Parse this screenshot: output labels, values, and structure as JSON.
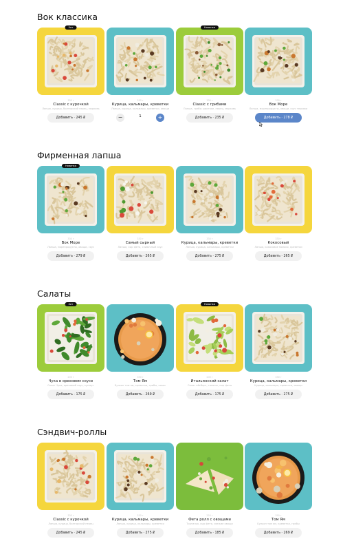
{
  "sections": [
    {
      "title": "Вок классика",
      "items": [
        {
          "name": "Classic с курочкой",
          "desc": "Лапша, курица, болгарский перец, морковь",
          "badge": "Хит",
          "button": "Добавить · 245 ₽",
          "bg": "#f5d63d",
          "food": "noodle-chicken",
          "weight": "330 г"
        },
        {
          "name": "Курица, кальмары, креветки",
          "desc": "Лапша, курица, кальмары, креветки, овощи",
          "badge": "",
          "button": "",
          "stepper": {
            "minus": "−",
            "count": "1",
            "plus": "+"
          },
          "bg": "#5dbfc6",
          "food": "noodle-seafood",
          "weight": "330 г"
        },
        {
          "name": "Classic с грибами",
          "desc": "Лапша, грибы шиитаке, перец, морковь",
          "badge": "Новинка",
          "button": "Добавить · 235 ₽",
          "bg": "#9ccc3b",
          "food": "noodle-mushroom",
          "weight": "330 г"
        },
        {
          "name": "Вок Море",
          "desc": "Лапша, морепродукты, овощи, соус терияки",
          "badge": "",
          "button": "Добавить · 278 ₽",
          "active": true,
          "bg": "#5dbfc6",
          "food": "noodle-seafood",
          "weight": "330 г"
        }
      ]
    },
    {
      "title": "Фирменная лапша",
      "items": [
        {
          "name": "Вок Море",
          "desc": "Лапша, морепродукты, овощи, соус",
          "badge": "Новинка",
          "button": "Добавить · 279 ₽",
          "bg": "#5dbfc6",
          "food": "noodle-seafood",
          "weight": "330 г"
        },
        {
          "name": "Самый сырный",
          "desc": "Лапша, сыр фета, сливочный соус",
          "badge": "",
          "button": "Добавить · 265 ₽",
          "bg": "#f5d63d",
          "food": "noodle-cheese",
          "weight": "330 г"
        },
        {
          "name": "Курица, кальмары, креветки",
          "desc": "Лапша, курица, кальмары, креветки",
          "badge": "",
          "button": "Добавить · 275 ₽",
          "bg": "#5dbfc6",
          "food": "noodle-seafood",
          "weight": "330 г"
        },
        {
          "name": "Кокосовый",
          "desc": "Лапша, кокосовое молоко, креветки",
          "badge": "",
          "button": "Добавить · 265 ₽",
          "bg": "#f5d63d",
          "food": "noodle-coconut",
          "weight": "330 г"
        }
      ]
    },
    {
      "title": "Салаты",
      "items": [
        {
          "name": "Чука в ореховом соусе",
          "desc": "Салат Чука, ореховый соус, кунжут",
          "badge": "Хит",
          "button": "Добавить · 175 ₽",
          "bg": "#9ccc3b",
          "food": "salad-chuka",
          "weight": "200 г"
        },
        {
          "name": "Том Ям",
          "desc": "Бульон том ям, креветки, грибы, кокос",
          "badge": "",
          "button": "Добавить · 269 ₽",
          "bg": "#5dbfc6",
          "food": "soup",
          "weight": "350 г"
        },
        {
          "name": "Итальянский салат",
          "desc": "Салат айсберг, томаты, сыр фета",
          "badge": "Новинка",
          "button": "Добавить · 175 ₽",
          "bg": "#f5d63d",
          "food": "salad-italian",
          "weight": "200 г"
        },
        {
          "name": "Курица, кальмары, креветки",
          "desc": "Курица, кальмары, креветки, овощи",
          "badge": "",
          "button": "Добавить · 275 ₽",
          "bg": "#5dbfc6",
          "food": "noodle-seafood",
          "weight": "330 г"
        }
      ]
    },
    {
      "title": "Сэндвич-роллы",
      "items": [
        {
          "name": "Classic с курочкой",
          "desc": "Лапша, курица, болгарский перец",
          "badge": "",
          "button": "Добавить · 245 ₽",
          "bg": "#f5d63d",
          "food": "noodle-chicken",
          "weight": "330 г"
        },
        {
          "name": "Курица, кальмары, креветки",
          "desc": "Лапша, курица, кальмары, креветки",
          "badge": "",
          "button": "Добавить · 275 ₽",
          "bg": "#5dbfc6",
          "food": "noodle-seafood",
          "weight": "330 г"
        },
        {
          "name": "Фета ролл с овощами",
          "desc": "Тортилья, сыр фета, свежие овощи",
          "badge": "",
          "button": "Добавить · 185 ₽",
          "bg": "#7cbd3c",
          "food": "roll",
          "weight": "220 г"
        },
        {
          "name": "Том Ям",
          "desc": "Бульон том ям, креветки, грибы",
          "badge": "",
          "button": "Добавить · 269 ₽",
          "bg": "#5dbfc6",
          "food": "soup",
          "weight": "350 г"
        }
      ]
    }
  ]
}
